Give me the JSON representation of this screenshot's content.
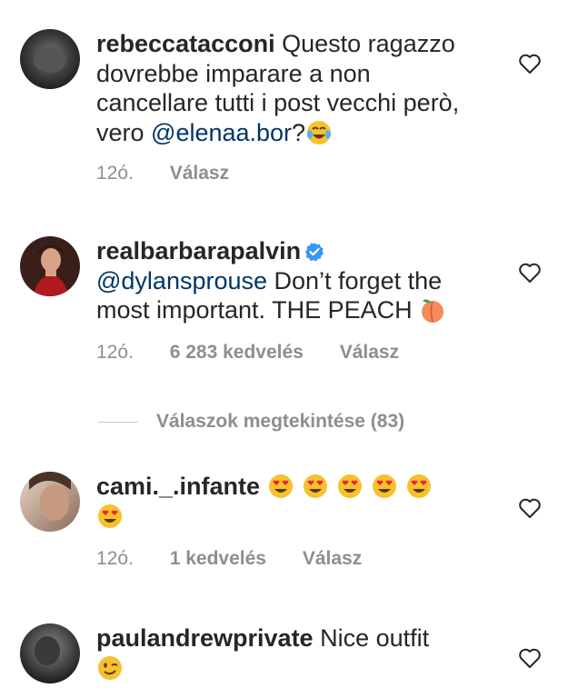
{
  "comments": [
    {
      "username": "rebeccatacconi",
      "text_before": "Questo ragazzo dovrebbe imparare a non cancellare tutti i post vecchi però, vero ",
      "mention": "@elenaa.bor",
      "text_after": "?",
      "emoji": [
        "face-with-tears-of-joy"
      ],
      "time": "12ó.",
      "reply": "Válasz"
    },
    {
      "username": "realbarbarapalvin",
      "verified": true,
      "mention": "@dylansprouse",
      "text_after": " Don’t forget the most important. THE PEACH ",
      "emoji": [
        "peach"
      ],
      "time": "12ó.",
      "likes": "6 283 kedvelés",
      "reply": "Válasz"
    },
    {
      "username": "cami._.infante",
      "emoji": [
        "heart-eyes",
        "heart-eyes",
        "heart-eyes",
        "heart-eyes",
        "heart-eyes",
        "heart-eyes"
      ],
      "time": "12ó.",
      "likes": "1 kedvelés",
      "reply": "Válasz"
    },
    {
      "username": "paulandrewprivate",
      "text": "Nice outfit",
      "emoji": [
        "winking-face"
      ]
    }
  ],
  "view_replies": "Válaszok megtekintése (83)",
  "colors": {
    "text": "#262626",
    "muted": "#8e8e8e",
    "mention": "#003569",
    "verified": "#3897f0"
  },
  "icons": {
    "like": "heart-outline-icon",
    "verified": "verified-badge-icon"
  }
}
